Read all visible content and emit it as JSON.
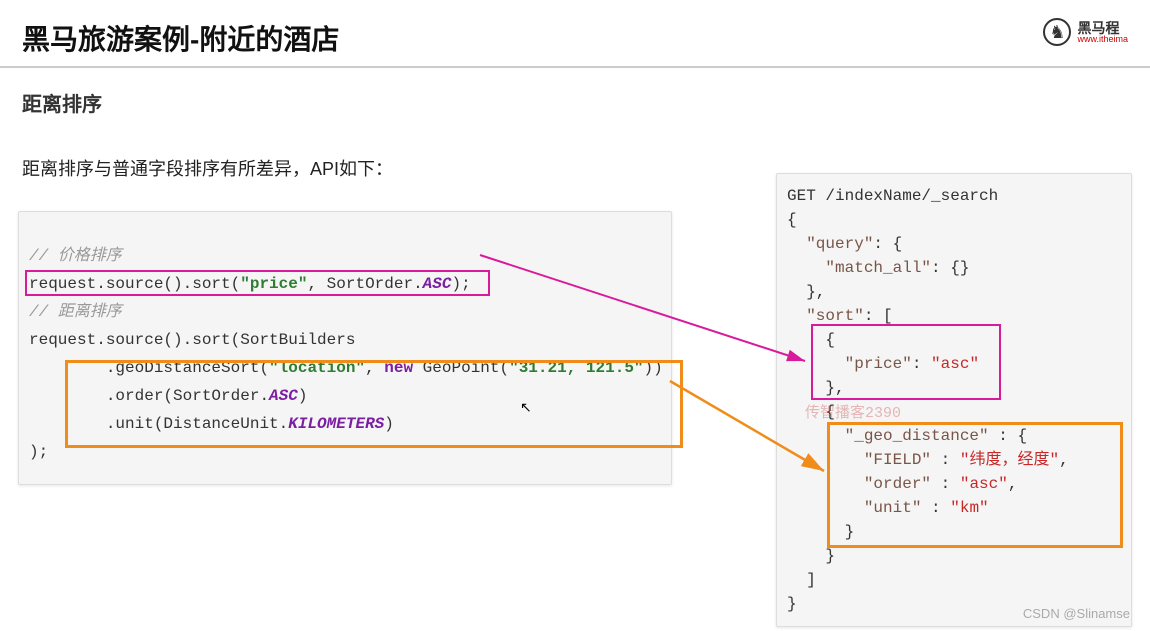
{
  "header": {
    "title": "黑马旅游案例-附近的酒店",
    "logo_cn": "黑马程",
    "logo_url": "www.itheima"
  },
  "subheader": "距离排序",
  "desc": "距离排序与普通字段排序有所差异，API如下：",
  "left": {
    "c1": "// 价格排序",
    "l1a": "request.source().sort(",
    "l1b": "\"price\"",
    "l1c": ", SortOrder.",
    "l1d": "ASC",
    "l1e": ");",
    "c2": "// 距离排序",
    "l2": "request.source().sort(SortBuilders",
    "l3a": "        .geoDistanceSort(",
    "l3b": "\"location\"",
    "l3c": ", ",
    "l3d": "new",
    "l3e": " GeoPoint(",
    "l3f": "\"31.21, 121.5\"",
    "l3g": "))",
    "l4a": "        .order(SortOrder.",
    "l4b": "ASC",
    "l4c": ")",
    "l5a": "        .unit(DistanceUnit.",
    "l5b": "KILOMETERS",
    "l5c": ")",
    "l6": ");"
  },
  "right": {
    "r1": "GET /indexName/_search",
    "r2": "{",
    "r3a": "  ",
    "r3b": "\"query\"",
    "r3c": ": {",
    "r4a": "    ",
    "r4b": "\"match_all\"",
    "r4c": ": {}",
    "r5": "  },",
    "r6a": "  ",
    "r6b": "\"sort\"",
    "r6c": ": [",
    "r7": "    {",
    "r8a": "      ",
    "r8b": "\"price\"",
    "r8c": ": ",
    "r8d": "\"asc\"",
    "r9": "    },",
    "r10": "    {",
    "r11a": "      ",
    "r11b": "\"_geo_distance\"",
    "r11c": " : {",
    "r12a": "        ",
    "r12b": "\"FIELD\"",
    "r12c": " : ",
    "r12d": "\"纬度，经度\"",
    "r12e": ",",
    "r13a": "        ",
    "r13b": "\"order\"",
    "r13c": " : ",
    "r13d": "\"asc\"",
    "r13e": ",",
    "r14a": "        ",
    "r14b": "\"unit\"",
    "r14c": " : ",
    "r14d": "\"km\"",
    "r15": "      }",
    "r16": "    }",
    "r17": "  ]",
    "r18": "}"
  },
  "watermarks": {
    "w1": "传智播客2390",
    "w2": "CSDN @Slinamse"
  }
}
